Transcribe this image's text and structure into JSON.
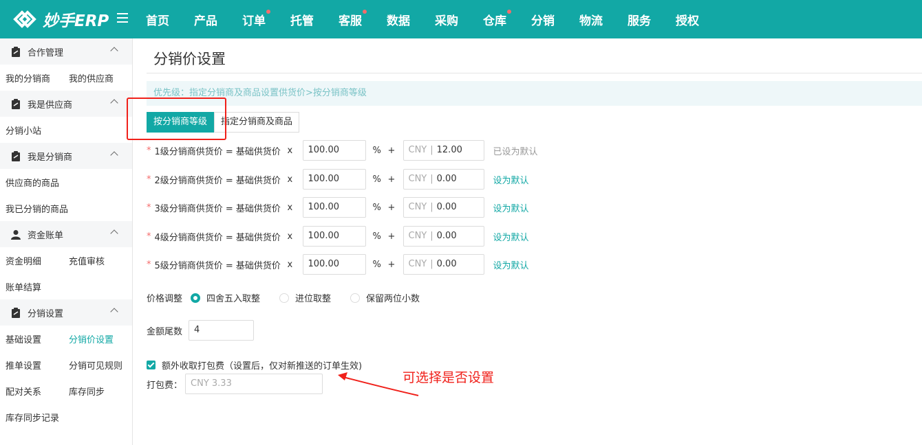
{
  "brand": {
    "name": "妙手ERP",
    "accent": "#12a8a5"
  },
  "nav": [
    {
      "label": "首页",
      "dot": false
    },
    {
      "label": "产品",
      "dot": false
    },
    {
      "label": "订单",
      "dot": true
    },
    {
      "label": "托管",
      "dot": false
    },
    {
      "label": "客服",
      "dot": true
    },
    {
      "label": "数据",
      "dot": false
    },
    {
      "label": "采购",
      "dot": false
    },
    {
      "label": "仓库",
      "dot": true
    },
    {
      "label": "分销",
      "dot": false
    },
    {
      "label": "物流",
      "dot": false
    },
    {
      "label": "服务",
      "dot": false
    },
    {
      "label": "授权",
      "dot": false
    }
  ],
  "sidebar": {
    "groups": [
      {
        "label": "合作管理",
        "icon": "clipboard-icon",
        "rows": [
          [
            "我的分销商",
            "我的供应商"
          ]
        ]
      },
      {
        "label": "我是供应商",
        "icon": "clipboard-icon",
        "rows": [
          [
            "分销小站"
          ]
        ]
      },
      {
        "label": "我是分销商",
        "icon": "clipboard-icon",
        "rows": [
          [
            "供应商的商品"
          ],
          [
            "我已分销的商品"
          ]
        ]
      },
      {
        "label": "资金账单",
        "icon": "user-icon",
        "rows": [
          [
            "资金明细",
            "充值审核"
          ],
          [
            "账单结算"
          ]
        ]
      },
      {
        "label": "分销设置",
        "icon": "clipboard-icon",
        "rows": [
          [
            "基础设置",
            "分销价设置"
          ],
          [
            "推单设置",
            "分销可见规则"
          ],
          [
            "配对关系",
            "库存同步"
          ],
          [
            "库存同步记录"
          ]
        ]
      }
    ],
    "active": "分销价设置"
  },
  "page": {
    "title": "分销价设置",
    "notice": "优先级：指定分销商及商品设置供货价>按分销商等级",
    "tabs": [
      {
        "label": "按分销商等级",
        "active": true
      },
      {
        "label": "指定分销商及商品",
        "active": false
      }
    ],
    "price_rows": [
      {
        "formula": "1级分销商供货价 = 基础供货价",
        "times": "x",
        "percent": "100.00",
        "pct": "%",
        "plus": "+",
        "currency": "CNY",
        "sep": "|",
        "amount": "12.00",
        "action": "已设为默认",
        "is_default": true
      },
      {
        "formula": "2级分销商供货价 = 基础供货价",
        "times": "x",
        "percent": "100.00",
        "pct": "%",
        "plus": "+",
        "currency": "CNY",
        "sep": "|",
        "amount": "0.00",
        "action": "设为默认",
        "is_default": false
      },
      {
        "formula": "3级分销商供货价 = 基础供货价",
        "times": "x",
        "percent": "100.00",
        "pct": "%",
        "plus": "+",
        "currency": "CNY",
        "sep": "|",
        "amount": "0.00",
        "action": "设为默认",
        "is_default": false
      },
      {
        "formula": "4级分销商供货价 = 基础供货价",
        "times": "x",
        "percent": "100.00",
        "pct": "%",
        "plus": "+",
        "currency": "CNY",
        "sep": "|",
        "amount": "0.00",
        "action": "设为默认",
        "is_default": false
      },
      {
        "formula": "5级分销商供货价 = 基础供货价",
        "times": "x",
        "percent": "100.00",
        "pct": "%",
        "plus": "+",
        "currency": "CNY",
        "sep": "|",
        "amount": "0.00",
        "action": "设为默认",
        "is_default": false
      }
    ],
    "rounding": {
      "label": "价格调整",
      "options": [
        "四舍五入取整",
        "进位取整",
        "保留两位小数"
      ],
      "selected": "四舍五入取整"
    },
    "tail": {
      "label": "金额尾数",
      "value": "4"
    },
    "packing": {
      "checkbox_label": "额外收取打包费（设置后，仅对新推送的订单生效)",
      "checked": true,
      "fee_label": "打包费：",
      "fee_placeholder": "CNY  3.33"
    },
    "annotation": "可选择是否设置"
  }
}
